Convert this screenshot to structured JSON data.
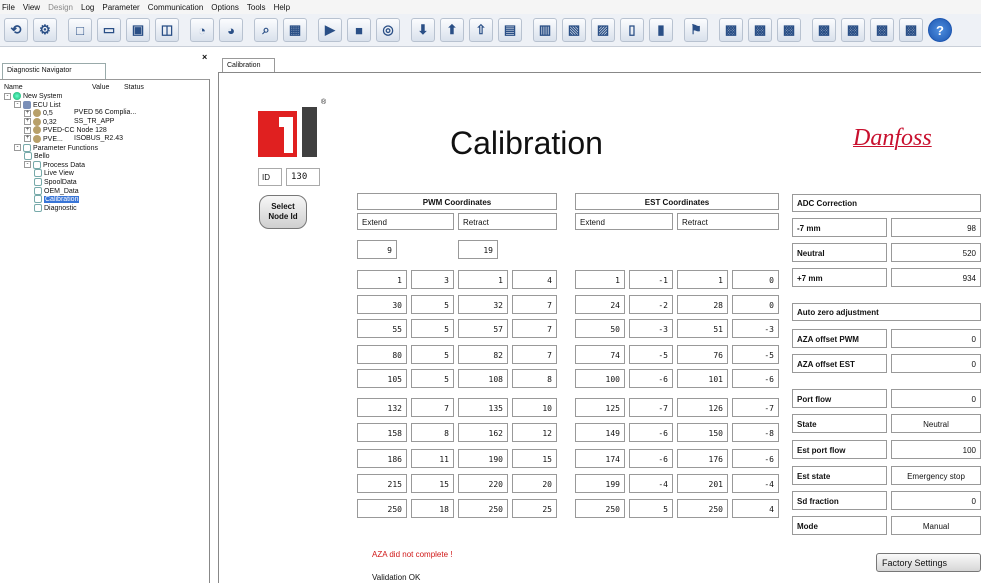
{
  "menu": [
    "File",
    "View",
    "Design",
    "Log",
    "Parameter",
    "Communication",
    "Options",
    "Tools",
    "Help"
  ],
  "toolbar_icons": [
    "open-icon",
    "connect-icon",
    "new-icon",
    "folder-icon",
    "save-icon",
    "window-icon",
    "node-icon",
    "node-add-icon",
    "find-icon",
    "view-icon",
    "play-icon",
    "stop-icon",
    "capture-icon",
    "download-icon",
    "upload-icon",
    "upload-all-icon",
    "doc-icon",
    "doc-print-icon",
    "doc-save-icon",
    "doc-export-icon",
    "doc-blank-icon",
    "doc-lock-icon",
    "flag-icon",
    "chip-a-icon",
    "chip-b-icon",
    "chip-c-icon",
    "chip-d-icon",
    "chip-e-icon",
    "chip-f-icon",
    "chip-g-icon",
    "help-icon"
  ],
  "navigator": {
    "tab": "Diagnostic Navigator",
    "columns": [
      "Name",
      "Value",
      "Status"
    ],
    "tree": [
      {
        "label": "New System",
        "indent": 0,
        "pm": "-",
        "icon": "sys",
        "col2": ""
      },
      {
        "label": "ECU List",
        "indent": 1,
        "pm": "-",
        "icon": "ecu",
        "col2": ""
      },
      {
        "label": "0,5",
        "indent": 2,
        "pm": "+",
        "icon": "node",
        "col2": "PVED 56 Complia..."
      },
      {
        "label": "0,32",
        "indent": 2,
        "pm": "+",
        "icon": "node",
        "col2": "SS_TR_APP"
      },
      {
        "label": "PVED-CC Node 128",
        "indent": 2,
        "pm": "+",
        "icon": "node",
        "col2": ""
      },
      {
        "label": "PVE...",
        "indent": 2,
        "pm": "+",
        "icon": "node",
        "col2": "ISOBUS_R2.43"
      },
      {
        "label": "Parameter Functions",
        "indent": 1,
        "pm": "-",
        "icon": "par",
        "col2": ""
      },
      {
        "label": "Bello",
        "indent": 2,
        "pm": "",
        "icon": "par",
        "col2": ""
      },
      {
        "label": "Process Data",
        "indent": 2,
        "pm": "-",
        "icon": "par",
        "col2": ""
      },
      {
        "label": "Live View",
        "indent": 3,
        "pm": "",
        "icon": "par",
        "col2": ""
      },
      {
        "label": "SpoolData",
        "indent": 3,
        "pm": "",
        "icon": "par",
        "col2": ""
      },
      {
        "label": "OEM_Data",
        "indent": 3,
        "pm": "",
        "icon": "par",
        "col2": ""
      },
      {
        "label": "Calibration",
        "indent": 3,
        "pm": "",
        "icon": "par",
        "col2": "",
        "selected": true
      },
      {
        "label": "Diagnostic",
        "indent": 3,
        "pm": "",
        "icon": "par",
        "col2": ""
      }
    ]
  },
  "calibration": {
    "tab": "Calibration",
    "title": "Calibration",
    "brand": "Danfoss",
    "id_label": "ID",
    "id_value": "130",
    "select_button": [
      "Select",
      "Node Id"
    ],
    "pwm": {
      "header": "PWM Coordinates",
      "extend_label": "Extend",
      "retract_label": "Retract",
      "extend_value": "9",
      "retract_value": "19",
      "rows": [
        [
          "1",
          "3",
          "1",
          "4"
        ],
        [
          "30",
          "5",
          "32",
          "7"
        ],
        [
          "55",
          "5",
          "57",
          "7"
        ],
        [
          "80",
          "5",
          "82",
          "7"
        ],
        [
          "105",
          "5",
          "108",
          "8"
        ],
        [
          "132",
          "7",
          "135",
          "10"
        ],
        [
          "158",
          "8",
          "162",
          "12"
        ],
        [
          "186",
          "11",
          "190",
          "15"
        ],
        [
          "215",
          "15",
          "220",
          "20"
        ],
        [
          "250",
          "18",
          "250",
          "25"
        ]
      ]
    },
    "est": {
      "header": "EST Coordinates",
      "extend_label": "Extend",
      "retract_label": "Retract",
      "rows": [
        [
          "1",
          "-1",
          "1",
          "0"
        ],
        [
          "24",
          "-2",
          "28",
          "0"
        ],
        [
          "50",
          "-3",
          "51",
          "-3"
        ],
        [
          "74",
          "-5",
          "76",
          "-5"
        ],
        [
          "100",
          "-6",
          "101",
          "-6"
        ],
        [
          "125",
          "-7",
          "126",
          "-7"
        ],
        [
          "149",
          "-6",
          "150",
          "-8"
        ],
        [
          "174",
          "-6",
          "176",
          "-6"
        ],
        [
          "199",
          "-4",
          "201",
          "-4"
        ],
        [
          "250",
          "5",
          "250",
          "4"
        ]
      ]
    },
    "adc": {
      "header": "ADC Correction",
      "rows": [
        {
          "label": "-7 mm",
          "value": "98"
        },
        {
          "label": "Neutral",
          "value": "520"
        },
        {
          "label": "+7 mm",
          "value": "934"
        }
      ]
    },
    "aza": {
      "header": "Auto zero adjustment",
      "rows": [
        {
          "label": "AZA offset PWM",
          "value": "0"
        },
        {
          "label": "AZA offset EST",
          "value": "0"
        }
      ]
    },
    "status": [
      {
        "label": "Port flow",
        "value": "0",
        "align": "r"
      },
      {
        "label": "State",
        "value": "Neutral",
        "align": "c"
      },
      {
        "label": "Est port flow",
        "value": "100",
        "align": "r"
      },
      {
        "label": "Est state",
        "value": "Emergency stop",
        "align": "c"
      },
      {
        "label": "Sd fraction",
        "value": "0",
        "align": "r"
      },
      {
        "label": "Mode",
        "value": "Manual",
        "align": "c"
      }
    ],
    "warning": "AZA did not complete !",
    "validation": "Validation OK",
    "factory_button": "Factory Settings"
  }
}
